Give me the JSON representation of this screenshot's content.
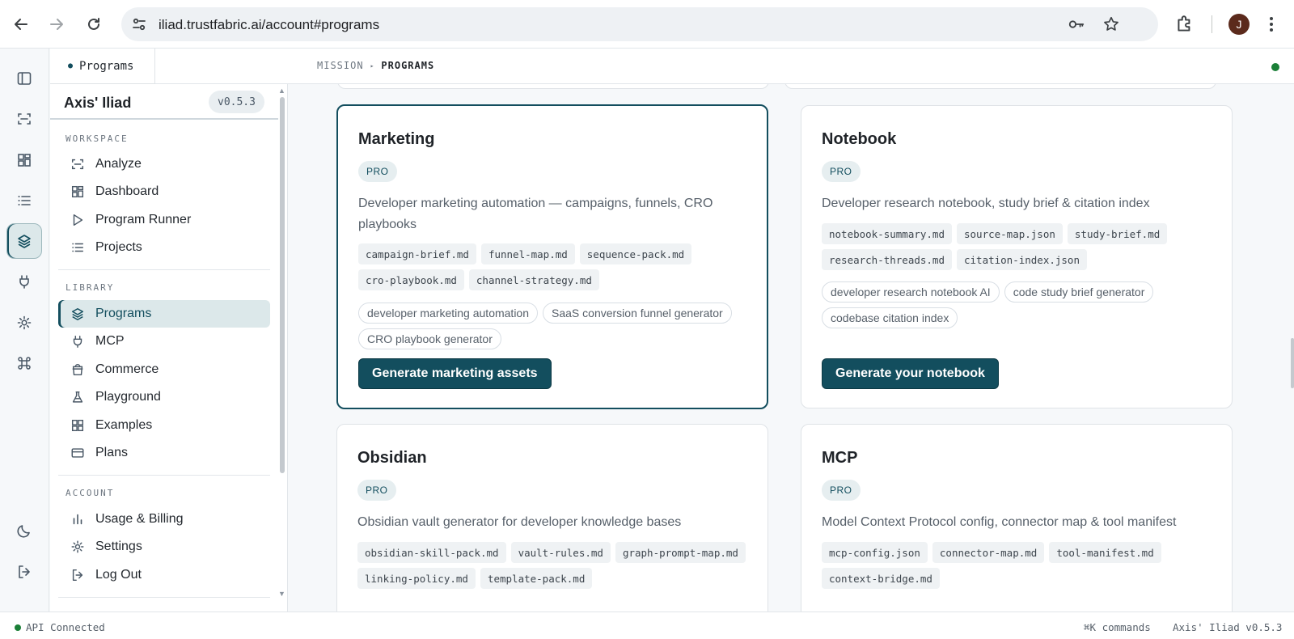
{
  "browser": {
    "url": "iliad.trustfabric.ai/account#programs",
    "avatar_initial": "J"
  },
  "header": {
    "tab_label": "Programs",
    "breadcrumb": [
      "MISSION",
      "PROGRAMS"
    ]
  },
  "sidebar": {
    "brand": "Axis' Iliad",
    "version": "v0.5.3",
    "sections": {
      "workspace": "WORKSPACE",
      "library": "LIBRARY",
      "account": "ACCOUNT"
    },
    "workspace_items": [
      {
        "label": "Analyze",
        "icon": "scan-icon"
      },
      {
        "label": "Dashboard",
        "icon": "grid-icon"
      },
      {
        "label": "Program Runner",
        "icon": "play-icon"
      },
      {
        "label": "Projects",
        "icon": "list-icon"
      }
    ],
    "library_items": [
      {
        "label": "Programs",
        "icon": "layers-icon",
        "active": true
      },
      {
        "label": "MCP",
        "icon": "plug-icon"
      },
      {
        "label": "Commerce",
        "icon": "shopping-bag-icon"
      },
      {
        "label": "Playground",
        "icon": "flask-icon"
      },
      {
        "label": "Examples",
        "icon": "grid-icon"
      },
      {
        "label": "Plans",
        "icon": "credit-card-icon"
      }
    ],
    "account_items": [
      {
        "label": "Usage & Billing",
        "icon": "bar-chart-icon"
      },
      {
        "label": "Settings",
        "icon": "gear-icon"
      },
      {
        "label": "Log Out",
        "icon": "logout-icon"
      }
    ]
  },
  "cards": [
    {
      "title": "Marketing",
      "badge": "PRO",
      "description": "Developer marketing automation — campaigns, funnels, CRO playbooks",
      "files": [
        "campaign-brief.md",
        "funnel-map.md",
        "sequence-pack.md",
        "cro-playbook.md",
        "channel-strategy.md"
      ],
      "tags": [
        "developer marketing automation",
        "SaaS conversion funnel generator",
        "CRO playbook generator"
      ],
      "cta": "Generate marketing assets"
    },
    {
      "title": "Notebook",
      "badge": "PRO",
      "description": "Developer research notebook, study brief & citation index",
      "files": [
        "notebook-summary.md",
        "source-map.json",
        "study-brief.md",
        "research-threads.md",
        "citation-index.json"
      ],
      "tags": [
        "developer research notebook AI",
        "code study brief generator",
        "codebase citation index"
      ],
      "cta": "Generate your notebook"
    },
    {
      "title": "Obsidian",
      "badge": "PRO",
      "description": "Obsidian vault generator for developer knowledge bases",
      "files": [
        "obsidian-skill-pack.md",
        "vault-rules.md",
        "graph-prompt-map.md",
        "linking-policy.md",
        "template-pack.md"
      ]
    },
    {
      "title": "MCP",
      "badge": "PRO",
      "description": "Model Context Protocol config, connector map & tool manifest",
      "files": [
        "mcp-config.json",
        "connector-map.md",
        "tool-manifest.md",
        "context-bridge.md"
      ]
    }
  ],
  "statusbar": {
    "api": "API Connected",
    "commands": "⌘K commands",
    "version": "Axis' Iliad v0.5.3"
  },
  "colors": {
    "accent": "#134e5e",
    "status_ok": "#1a7f37",
    "active_bg": "#dce8ea"
  }
}
